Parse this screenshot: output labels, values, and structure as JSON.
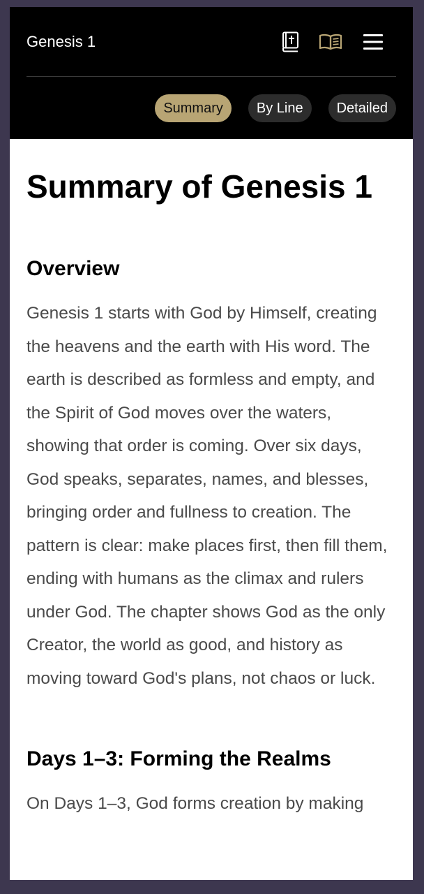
{
  "header": {
    "title": "Genesis 1",
    "icons": [
      "bible-icon",
      "open-book-icon",
      "hamburger-menu-icon"
    ],
    "accent_color": "#b8a574"
  },
  "tabs": [
    {
      "label": "Summary",
      "active": true
    },
    {
      "label": "By Line",
      "active": false
    },
    {
      "label": "Detailed",
      "active": false
    }
  ],
  "main": {
    "title": "Summary of Genesis 1",
    "sections": [
      {
        "heading": "Overview",
        "text": "Genesis 1 starts with God by Himself, creating the heavens and the earth with His word. The earth is described as formless and empty, and the Spirit of God moves over the waters, showing that order is coming. Over six days, God speaks, separates, names, and blesses, bringing order and fullness to creation. The pattern is clear: make places first, then fill them, ending with humans as the climax and rulers under God. The chapter shows God as the only Creator, the world as good, and history as moving toward God's plans, not chaos or luck."
      },
      {
        "heading": "Days 1–3: Forming the Realms",
        "text": "On Days 1–3, God forms creation by making"
      }
    ]
  }
}
